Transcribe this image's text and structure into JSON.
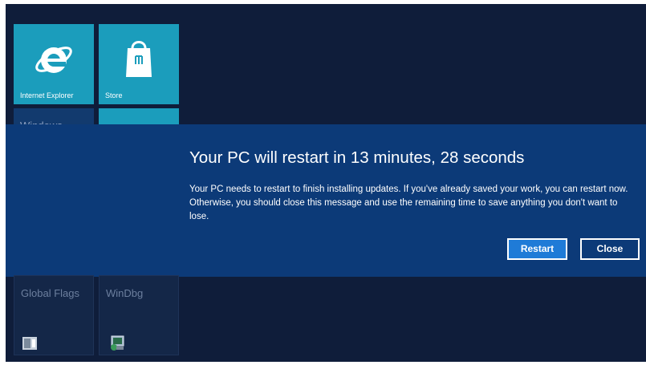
{
  "start_tiles": [
    {
      "label": "Internet Explorer",
      "icon": "internet-explorer-icon"
    },
    {
      "label": "Store",
      "icon": "store-bag-icon"
    },
    {
      "label": "Windows",
      "icon": ""
    },
    {
      "label": "",
      "icon": ""
    },
    {
      "label": "Global Flags",
      "icon": "global-flags-icon"
    },
    {
      "label": "WinDbg",
      "icon": "windbg-icon"
    }
  ],
  "dialog": {
    "title": "Your PC will restart in 13 minutes, 28 seconds",
    "body": "Your PC needs to restart to finish installing updates. If you've already saved your work, you can restart now. Otherwise, you should close this message and use the remaining time to save anything you don't want to lose.",
    "restart_label": "Restart",
    "close_label": "Close"
  },
  "colors": {
    "background": "#0f1d3a",
    "banner": "#0c3a78",
    "tile_accent": "#1b9dbc",
    "primary_button": "#1f7bd7"
  }
}
